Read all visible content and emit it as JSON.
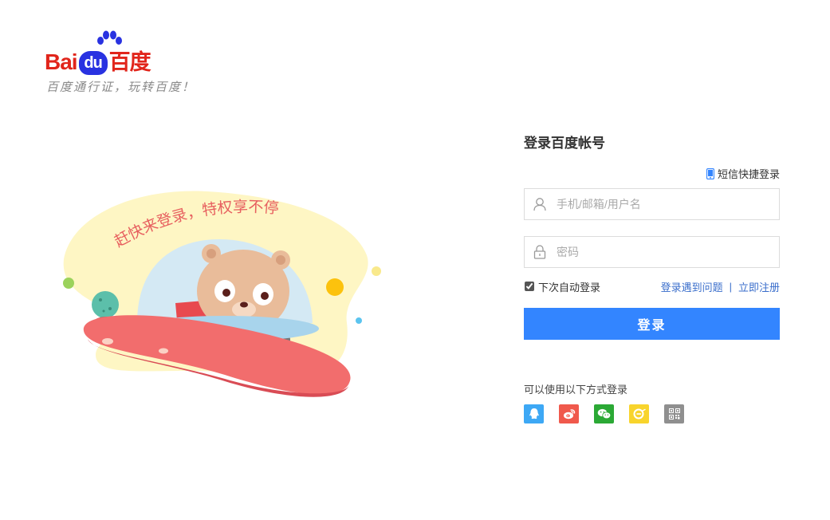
{
  "logo": {
    "bai": "Bai",
    "du": "du",
    "cn": "百度",
    "slogan": "百度通行证，玩转百度！"
  },
  "illustration": {
    "caption": "赶快来登录，特权享不停"
  },
  "login": {
    "title": "登录百度帐号",
    "sms_link": "短信快捷登录",
    "username_placeholder": "手机/邮箱/用户名",
    "password_placeholder": "密码",
    "remember_label": "下次自动登录",
    "remember_checked": true,
    "problem_link": "登录遇到问题",
    "separator": "|",
    "register_link": "立即注册",
    "submit_label": "登录",
    "alt_label": "可以使用以下方式登录"
  },
  "social_logins": [
    {
      "name": "qq",
      "icon": "qq-icon",
      "color": "#3da8f5"
    },
    {
      "name": "weibo",
      "icon": "weibo-icon",
      "color": "#f0594c"
    },
    {
      "name": "wechat",
      "icon": "wechat-icon",
      "color": "#2ba935"
    },
    {
      "name": "yy",
      "icon": "yy-icon",
      "color": "#f8d42c"
    },
    {
      "name": "qrcode",
      "icon": "qrcode-icon",
      "color": "#8f8f8f"
    }
  ],
  "colors": {
    "brand_red": "#e1251b",
    "brand_blue": "#2932e1",
    "primary_button": "#3385ff",
    "link": "#3a6ecb"
  }
}
